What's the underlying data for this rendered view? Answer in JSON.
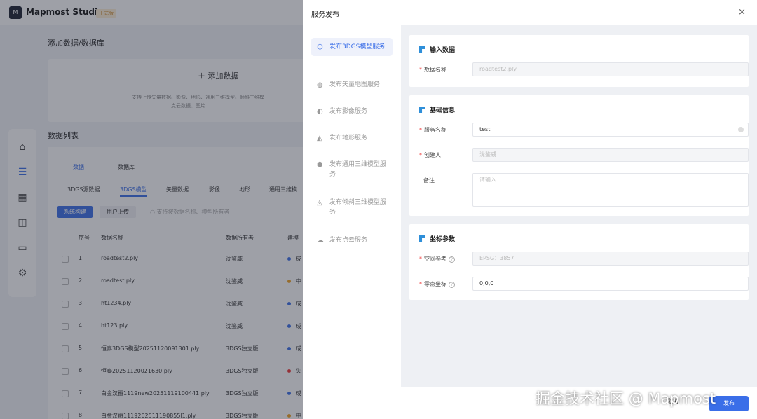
{
  "app": {
    "title": "Mapmost Studio",
    "badge": "正式版",
    "logo_text": "M"
  },
  "background": {
    "add_section_title": "添加数据/数据库",
    "add_button": "添加数据",
    "add_hint_line1": "支持上传矢量数据、影像、地形、通用三维模型、倾斜三维模",
    "add_hint_line2": "点云数据、图片",
    "list_title": "数据列表",
    "top_tabs": [
      "数据",
      "数据库"
    ],
    "type_tabs": [
      "3DGS源数据",
      "3DGS模型",
      "矢量数据",
      "影像",
      "地形",
      "通用三维模"
    ],
    "sub_tabs": [
      "系统构建",
      "用户上传"
    ],
    "search_placeholder": "支持按数据名称、模型所有者",
    "columns": [
      "序号",
      "数据名称",
      "数据所有者",
      "建模"
    ],
    "rows": [
      {
        "no": "1",
        "name": "roadtest2.ply",
        "owner": "沈鉴威",
        "status": "成",
        "color": "#3a6ee8"
      },
      {
        "no": "2",
        "name": "roadtest.ply",
        "owner": "沈鉴威",
        "status": "中",
        "color": "#f0a020"
      },
      {
        "no": "3",
        "name": "ht1234.ply",
        "owner": "沈鉴威",
        "status": "成",
        "color": "#3a6ee8"
      },
      {
        "no": "4",
        "name": "ht123.ply",
        "owner": "沈鉴威",
        "status": "成",
        "color": "#3a6ee8"
      },
      {
        "no": "5",
        "name": "恒泰3DGS模型20251120091301.ply",
        "owner": "3DGS独立版",
        "status": "成",
        "color": "#3a6ee8"
      },
      {
        "no": "6",
        "name": "恒泰20251120021630.ply",
        "owner": "3DGS独立版",
        "status": "失",
        "color": "#e33"
      },
      {
        "no": "7",
        "name": "白金汉爵1119new20251119100441.ply",
        "owner": "3DGS独立版",
        "status": "成",
        "color": "#3a6ee8"
      },
      {
        "no": "8",
        "name": "白金汉爵1119202511190855l1.ply",
        "owner": "3DGS独立版",
        "status": "中",
        "color": "#f0a020"
      }
    ]
  },
  "drawer": {
    "title": "服务发布",
    "nav": [
      {
        "label": "发布3DGS模型服务",
        "icon": "⬡"
      },
      {
        "label": "发布矢量地图服务",
        "icon": "◍"
      },
      {
        "label": "发布影像服务",
        "icon": "◐"
      },
      {
        "label": "发布地形服务",
        "icon": "◭"
      },
      {
        "label": "发布通用三维模型服务",
        "icon": "⬢"
      },
      {
        "label": "发布倾斜三维模型服务",
        "icon": "◬"
      },
      {
        "label": "发布点云服务",
        "icon": "☁"
      }
    ],
    "input_section": {
      "title": "输入数据",
      "data_name_label": "数据名称",
      "data_name_value": "roadtest2.ply"
    },
    "basic_section": {
      "title": "基础信息",
      "service_name_label": "服务名称",
      "service_name_value": "test",
      "creator_label": "创建人",
      "creator_value": "沈鉴威",
      "remark_label": "备注",
      "remark_placeholder": "请输入"
    },
    "coord_section": {
      "title": "坐标参数",
      "spatial_ref_label": "空间参考",
      "spatial_ref_value": "EPSG：3857",
      "origin_label": "零点坐标",
      "origin_value": "0,0,0"
    },
    "footer": {
      "cancel": "取消",
      "publish": "发布"
    }
  },
  "watermark": "掘金技术社区 @ Mapmost"
}
